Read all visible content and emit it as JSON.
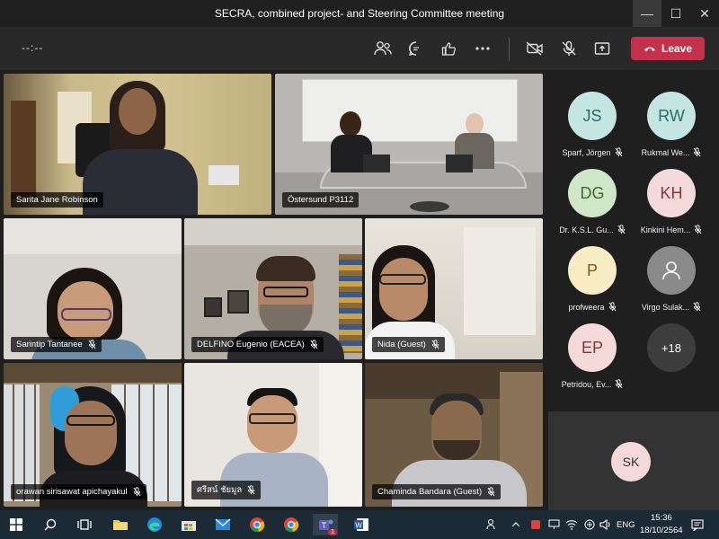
{
  "window": {
    "title": "SECRA, combined project- and Steering Committee meeting",
    "minimize": "—",
    "maximize": "☐",
    "close": "✕"
  },
  "toolbar": {
    "timer": "--:--",
    "leave_label": "Leave"
  },
  "tiles": [
    {
      "name": "Sarita Jane Robinson",
      "muted": false
    },
    {
      "name": "Östersund P3112",
      "muted": false
    },
    {
      "name": "Sarintip Tantanee",
      "muted": true
    },
    {
      "name": "DELFINO Eugenio (EACEA)",
      "muted": true
    },
    {
      "name": "Nida (Guest)",
      "muted": true
    },
    {
      "name": "orawan sirisawat apichayakul",
      "muted": true
    },
    {
      "name": "ศรีสน์ ชัยมูล",
      "muted": true
    },
    {
      "name": "Chaminda Bandara (Guest)",
      "muted": true
    }
  ],
  "roster": [
    {
      "initials": "JS",
      "name": "Sparf, Jörgen",
      "bg": "#c4e5e2"
    },
    {
      "initials": "RW",
      "name": "Rukmal We...",
      "bg": "#c4e5e2"
    },
    {
      "initials": "DG",
      "name": "Dr. K.S.L. Gu...",
      "bg": "#cfe7c6"
    },
    {
      "initials": "KH",
      "name": "Kinkini Hem...",
      "bg": "#f3d9d9"
    },
    {
      "initials": "P",
      "name": "profweera",
      "bg": "#f8ecc4"
    },
    {
      "initials": "",
      "name": "Virgo Sulak...",
      "bg": "#8a8a8a"
    },
    {
      "initials": "EP",
      "name": "Petridou, Ev...",
      "bg": "#f3d9d9"
    },
    {
      "initials": "+18",
      "name": "",
      "bg": "#3d3d3d"
    }
  ],
  "self_view": {
    "initials": "SK"
  },
  "taskbar": {
    "language": "ENG",
    "time": "15:36",
    "date": "18/10/2564",
    "teams_badge": "1"
  },
  "colors": {
    "leave": "#c4314b",
    "active_speaker": "#8f8be8",
    "taskbar": "#1c2a36"
  }
}
